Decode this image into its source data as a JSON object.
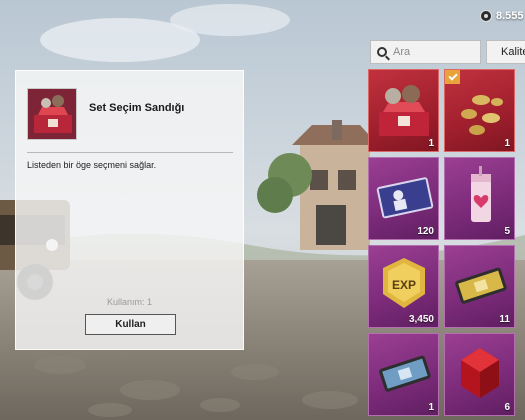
{
  "currency": {
    "amount": "8.555",
    "icon": "coin-icon"
  },
  "search": {
    "placeholder": "Ara"
  },
  "category_button": {
    "label": "Kalite"
  },
  "panel": {
    "title": "Set Seçim Sandığı",
    "description": "Listeden bir öge seçmeni sağlar.",
    "usage": "Kullanım: 1",
    "use_label": "Kullan"
  },
  "items": [
    {
      "name": "set-chest",
      "qty": "1",
      "selected": true
    },
    {
      "name": "coins",
      "qty": "1",
      "checked": true
    },
    {
      "name": "ticket-card",
      "qty": "120"
    },
    {
      "name": "heart-drink",
      "qty": "5"
    },
    {
      "name": "exp-badge",
      "qty": "3,450"
    },
    {
      "name": "gold-voucher",
      "qty": "11"
    },
    {
      "name": "silver-voucher",
      "qty": "1"
    },
    {
      "name": "red-gem",
      "qty": "6"
    }
  ],
  "colors": {
    "slot_purple": "#8a3386",
    "slot_red": "#b32634",
    "badge_orange": "#e8a33a"
  }
}
